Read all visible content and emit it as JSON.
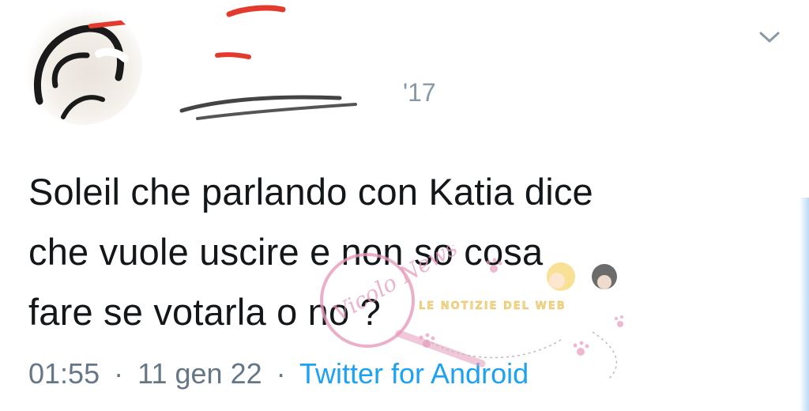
{
  "tweet": {
    "text": "Soleil che parlando con Katia dice\nche vuole uscire e non so cosa\nfare se votarla o no ?",
    "time": "01:55",
    "separator": "·",
    "date": "11 gen 22",
    "source": "Twitter for Android"
  },
  "header": {
    "handle_fragment": "'17",
    "menu_icon": "chevron-down-icon"
  },
  "watermark": {
    "circle_text": "Vicolo News",
    "banner_text": "LE NOTIZIE DEL WEB",
    "color_pink": "#e79bbd",
    "color_gold": "#f0c85a"
  },
  "colors": {
    "text": "#14171a",
    "meta": "#657786",
    "link": "#1da1f2",
    "redaction_red": "#e23b2e"
  }
}
